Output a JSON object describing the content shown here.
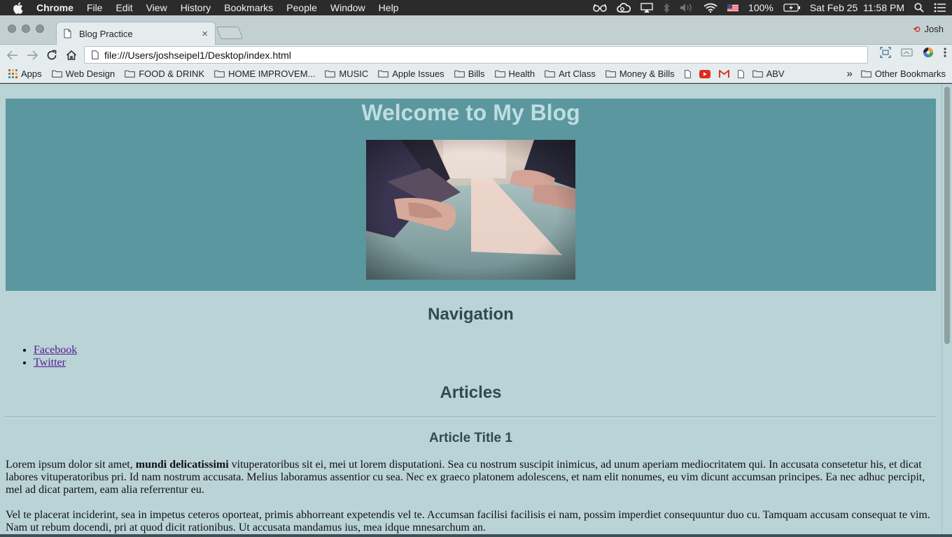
{
  "menubar": {
    "app": "Chrome",
    "items": [
      "File",
      "Edit",
      "View",
      "History",
      "Bookmarks",
      "People",
      "Window",
      "Help"
    ],
    "battery": "100%",
    "clock": "Sat Feb 25  11:58 PM"
  },
  "browser": {
    "tab_title": "Blog Practice",
    "tab_close": "×",
    "profile_name": "Josh",
    "url": "file:///Users/joshseipel1/Desktop/index.html"
  },
  "bookmarks": {
    "apps": "Apps",
    "folders": [
      "Web Design",
      "FOOD & DRINK",
      "HOME IMPROVEM...",
      "MUSIC",
      "Apple Issues",
      "Bills",
      "Health",
      "Art Class",
      "Money & Bills"
    ],
    "last_folder": "ABV",
    "overflow": "»",
    "other": "Other Bookmarks"
  },
  "page": {
    "heading": "Welcome to My Blog",
    "nav_title": "Navigation",
    "links": [
      "Facebook",
      "Twitter"
    ],
    "articles_title": "Articles",
    "article_title": "Article Title 1",
    "para1_a": "Lorem ipsum dolor sit amet, ",
    "para1_bold": "mundi delicatissimi",
    "para1_b": " vituperatoribus sit ei, mei ut lorem disputationi. Sea cu nostrum suscipit inimicus, ad unum aperiam mediocritatem qui. In accusata consetetur his, et dicat labores vituperatoribus pri. Id nam nostrum accusata. Melius laboramus assentior cu sea. Nec ex graeco platonem adolescens, et nam elit nonumes, eu vim dicunt accumsan principes. Ea nec adhuc percipit, mel ad dicat partem, eam alia referrentur eu.",
    "para2": "Vel te placerat inciderint, sea in impetus ceteros oporteat, primis abhorreant expetendis vel te. Accumsan facilisi facilisis ei nam, possim imperdiet consequuntur duo cu. Tamquam accusam consequat te vim. Nam ut rebum docendi, pri at quod dicit rationibus. Ut accusata mandamus ius, mea idque mnesarchum an."
  },
  "colors": {
    "page_bg": "#bad3d7",
    "header_bg": "#5b979f",
    "heading_text": "#bfdde0",
    "section_text": "#2f4b4f",
    "link": "#551a8b"
  },
  "icons": [
    "apple-icon",
    "glasses-icon",
    "creative-cloud-icon",
    "airplay-icon",
    "bluetooth-icon",
    "volume-icon",
    "wifi-icon",
    "flag-icon",
    "battery-icon",
    "spotlight-icon",
    "notification-center-icon",
    "back-icon",
    "forward-icon",
    "reload-icon",
    "home-icon",
    "page-icon",
    "screenshot-icon",
    "cast-icon",
    "extension-icon",
    "chrome-menu-icon",
    "apps-grid-icon",
    "folder-icon",
    "youtube-icon",
    "gmail-icon"
  ]
}
